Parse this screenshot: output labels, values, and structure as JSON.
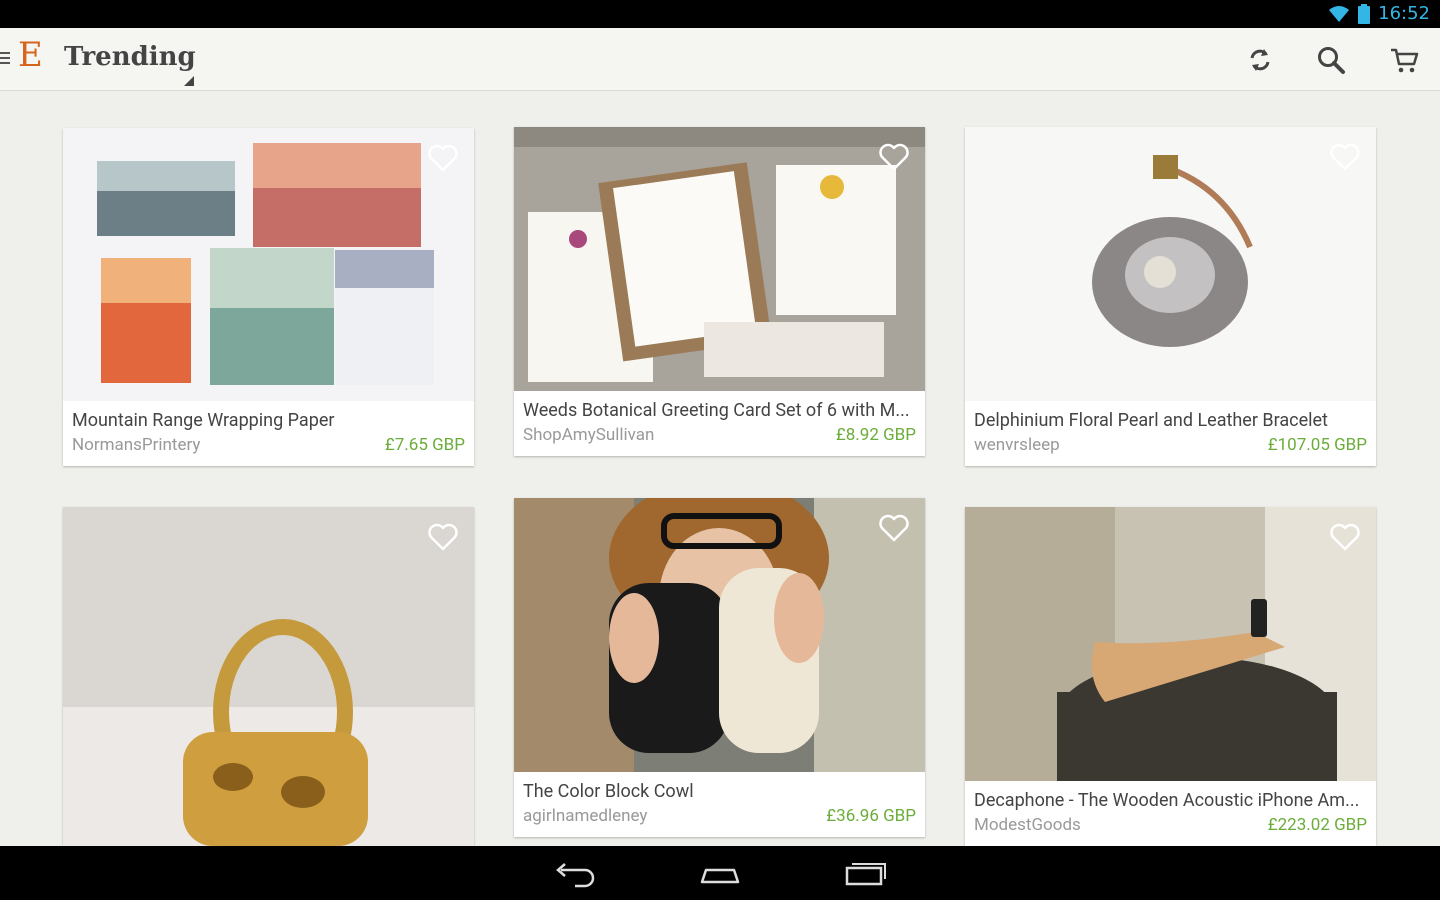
{
  "status_bar": {
    "time": "16:52"
  },
  "action_bar": {
    "title": "Trending",
    "logo": "E",
    "icons": [
      "refresh-icon",
      "search-icon",
      "cart-icon"
    ]
  },
  "listings": [
    {
      "title": "Mountain Range Wrapping Paper",
      "shop": "NormansPrintery",
      "price": "£7.65 GBP"
    },
    {
      "title": "Weeds Botanical Greeting Card Set of 6 with M...",
      "shop": "ShopAmySullivan",
      "price": "£8.92 GBP"
    },
    {
      "title": "Delphinium Floral Pearl and Leather Bracelet",
      "shop": "wenvrsleep",
      "price": "£107.05 GBP"
    },
    {
      "title": "",
      "shop": "",
      "price": ""
    },
    {
      "title": "The Color Block Cowl",
      "shop": "agirlnamedleney",
      "price": "£36.96 GBP"
    },
    {
      "title": "Decaphone - The Wooden Acoustic iPhone Am...",
      "shop": "ModestGoods",
      "price": "£223.02 GBP"
    }
  ],
  "colors": {
    "accent": "#d5641c",
    "price": "#6bad3a",
    "status": "#33b5e5"
  }
}
